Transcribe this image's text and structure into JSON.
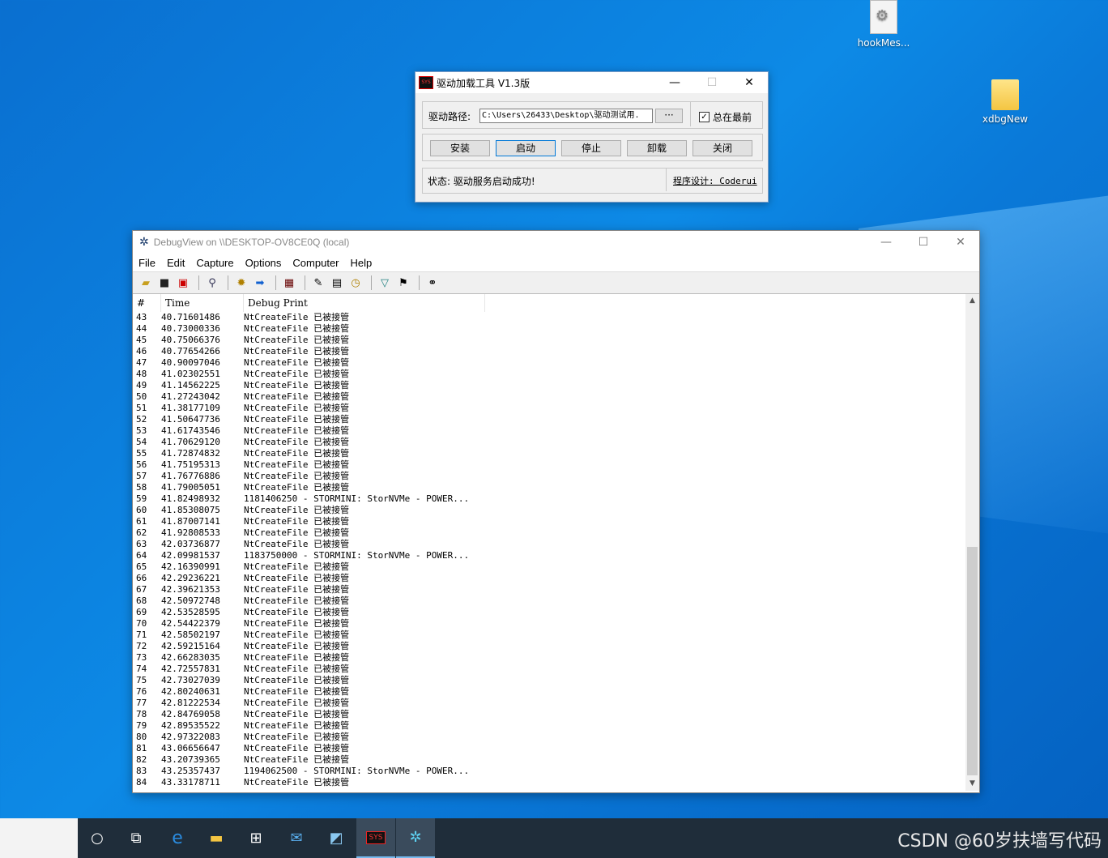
{
  "desktop": {
    "icons": [
      {
        "label": "hookMes..."
      },
      {
        "label": "xdbgNew"
      }
    ]
  },
  "driver_tool": {
    "title": "驱动加载工具 V1.3版",
    "icon_text": "SYS",
    "path_label": "驱动路径:",
    "path_value": "C:\\Users\\26433\\Desktop\\驱动测试用.",
    "browse_label": "···",
    "topmost_label": "总在最前",
    "topmost_checked": true,
    "buttons": {
      "install": "安装",
      "start": "启动",
      "stop": "停止",
      "unload": "卸载",
      "close": "关闭"
    },
    "status": "状态: 驱动服务启动成功!",
    "credit": "程序设计: Coderui"
  },
  "debugview": {
    "title": "DebugView on \\\\DESKTOP-OV8CE0Q (local)",
    "menu": [
      "File",
      "Edit",
      "Capture",
      "Options",
      "Computer",
      "Help"
    ],
    "columns": [
      "#",
      "Time",
      "Debug Print"
    ],
    "rows": [
      [
        "43",
        "40.71601486",
        "NtCreateFile 已被接管"
      ],
      [
        "44",
        "40.73000336",
        "NtCreateFile 已被接管"
      ],
      [
        "45",
        "40.75066376",
        "NtCreateFile 已被接管"
      ],
      [
        "46",
        "40.77654266",
        "NtCreateFile 已被接管"
      ],
      [
        "47",
        "40.90097046",
        "NtCreateFile 已被接管"
      ],
      [
        "48",
        "41.02302551",
        "NtCreateFile 已被接管"
      ],
      [
        "49",
        "41.14562225",
        "NtCreateFile 已被接管"
      ],
      [
        "50",
        "41.27243042",
        "NtCreateFile 已被接管"
      ],
      [
        "51",
        "41.38177109",
        "NtCreateFile 已被接管"
      ],
      [
        "52",
        "41.50647736",
        "NtCreateFile 已被接管"
      ],
      [
        "53",
        "41.61743546",
        "NtCreateFile 已被接管"
      ],
      [
        "54",
        "41.70629120",
        "NtCreateFile 已被接管"
      ],
      [
        "55",
        "41.72874832",
        "NtCreateFile 已被接管"
      ],
      [
        "56",
        "41.75195313",
        "NtCreateFile 已被接管"
      ],
      [
        "57",
        "41.76776886",
        "NtCreateFile 已被接管"
      ],
      [
        "58",
        "41.79005051",
        "NtCreateFile 已被接管"
      ],
      [
        "59",
        "41.82498932",
        "1181406250 - STORMINI: StorNVMe - POWER..."
      ],
      [
        "60",
        "41.85308075",
        "NtCreateFile 已被接管"
      ],
      [
        "61",
        "41.87007141",
        "NtCreateFile 已被接管"
      ],
      [
        "62",
        "41.92808533",
        "NtCreateFile 已被接管"
      ],
      [
        "63",
        "42.03736877",
        "NtCreateFile 已被接管"
      ],
      [
        "64",
        "42.09981537",
        "1183750000 - STORMINI: StorNVMe - POWER..."
      ],
      [
        "65",
        "42.16390991",
        "NtCreateFile 已被接管"
      ],
      [
        "66",
        "42.29236221",
        "NtCreateFile 已被接管"
      ],
      [
        "67",
        "42.39621353",
        "NtCreateFile 已被接管"
      ],
      [
        "68",
        "42.50972748",
        "NtCreateFile 已被接管"
      ],
      [
        "69",
        "42.53528595",
        "NtCreateFile 已被接管"
      ],
      [
        "70",
        "42.54422379",
        "NtCreateFile 已被接管"
      ],
      [
        "71",
        "42.58502197",
        "NtCreateFile 已被接管"
      ],
      [
        "72",
        "42.59215164",
        "NtCreateFile 已被接管"
      ],
      [
        "73",
        "42.66283035",
        "NtCreateFile 已被接管"
      ],
      [
        "74",
        "42.72557831",
        "NtCreateFile 已被接管"
      ],
      [
        "75",
        "42.73027039",
        "NtCreateFile 已被接管"
      ],
      [
        "76",
        "42.80240631",
        "NtCreateFile 已被接管"
      ],
      [
        "77",
        "42.81222534",
        "NtCreateFile 已被接管"
      ],
      [
        "78",
        "42.84769058",
        "NtCreateFile 已被接管"
      ],
      [
        "79",
        "42.89535522",
        "NtCreateFile 已被接管"
      ],
      [
        "80",
        "42.97322083",
        "NtCreateFile 已被接管"
      ],
      [
        "81",
        "43.06656647",
        "NtCreateFile 已被接管"
      ],
      [
        "82",
        "43.20739365",
        "NtCreateFile 已被接管"
      ],
      [
        "83",
        "43.25357437",
        "1194062500 - STORMINI: StorNVMe - POWER..."
      ],
      [
        "84",
        "43.33178711",
        "NtCreateFile 已被接管"
      ]
    ]
  },
  "taskbar": {
    "sys_icon_text": "SYS",
    "items": [
      "cortana-circle-icon",
      "task-view-icon",
      "edge-icon",
      "file-explorer-icon",
      "store-icon",
      "mail-icon",
      "installer-icon",
      "sys-driver-icon",
      "debugview-icon"
    ]
  },
  "watermark": "CSDN @60岁扶墙写代码"
}
